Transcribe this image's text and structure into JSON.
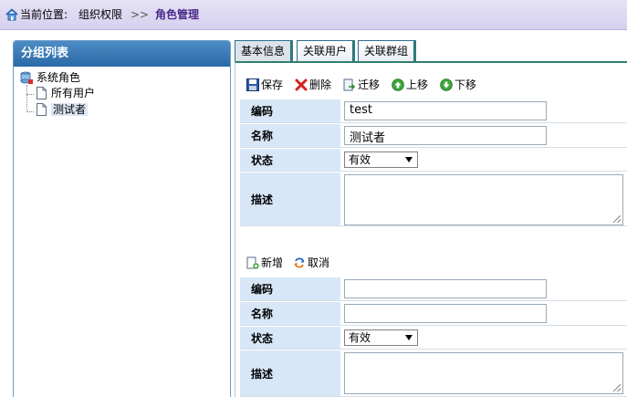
{
  "breadcrumb": {
    "prefix": "当前位置:",
    "path": "组织权限",
    "separator": ">>",
    "current": "角色管理"
  },
  "left_panel": {
    "title": "分组列表",
    "tree": {
      "root": "系统角色",
      "children": [
        "所有用户",
        "测试者"
      ]
    }
  },
  "tabs": [
    "基本信息",
    "关联用户",
    "关联群组"
  ],
  "toolbar_top": {
    "save": "保存",
    "delete": "删除",
    "move": "迁移",
    "up": "上移",
    "down": "下移"
  },
  "form_top": {
    "code_label": "编码",
    "code_value": "test",
    "name_label": "名称",
    "name_value": "测试者",
    "status_label": "状态",
    "status_value": "有效",
    "desc_label": "描述"
  },
  "toolbar_bottom": {
    "add": "新增",
    "cancel": "取消"
  },
  "form_bottom": {
    "code_label": "编码",
    "code_value": "",
    "name_label": "名称",
    "name_value": "",
    "status_label": "状态",
    "status_value": "有效",
    "desc_label": "描述"
  },
  "colors": {
    "header_blue": "#2b68a7",
    "label_bg": "#d7e7f8",
    "breadcrumb_current": "#4b2a8a",
    "tab_accent": "#2f7f6f"
  },
  "icons": {
    "home": "home-icon",
    "root": "database-icon",
    "leaf": "document-icon",
    "save": "floppy-disk-icon",
    "delete": "red-x-icon",
    "move": "move-document-icon",
    "up": "green-up-arrow-icon",
    "down": "green-down-arrow-icon",
    "add": "add-document-icon",
    "cancel": "refresh-cancel-icon"
  }
}
